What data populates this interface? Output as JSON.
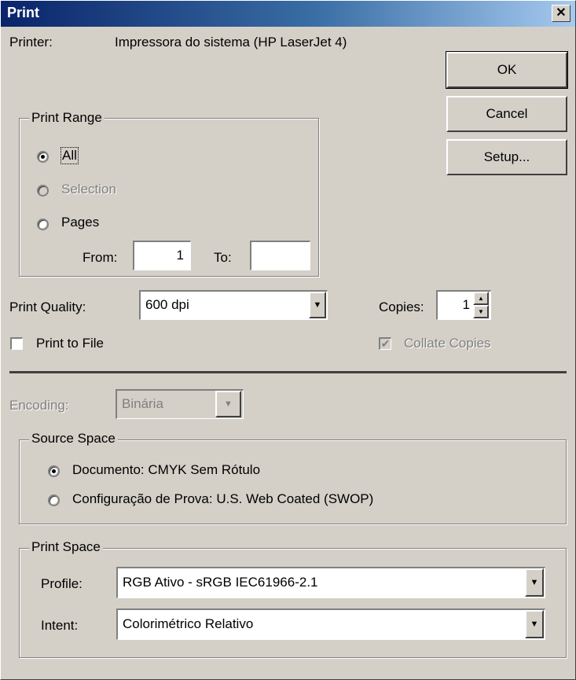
{
  "window": {
    "title": "Print",
    "close_glyph": "✕"
  },
  "printer": {
    "label": "Printer:",
    "value": "Impressora do sistema (HP LaserJet 4)"
  },
  "buttons": {
    "ok": "OK",
    "cancel": "Cancel",
    "setup": "Setup..."
  },
  "print_range": {
    "legend": "Print Range",
    "options": [
      {
        "label": "All",
        "checked": true,
        "enabled": true
      },
      {
        "label": "Selection",
        "checked": false,
        "enabled": false
      },
      {
        "label": "Pages",
        "checked": false,
        "enabled": true
      }
    ],
    "from_label": "From:",
    "from_value": "1",
    "to_label": "To:",
    "to_value": ""
  },
  "quality": {
    "label": "Print Quality:",
    "value": "600 dpi"
  },
  "copies": {
    "label": "Copies:",
    "value": "1"
  },
  "print_to_file": {
    "label": "Print to File",
    "checked": false
  },
  "collate": {
    "label": "Collate Copies",
    "checked": true,
    "enabled": false
  },
  "encoding": {
    "label": "Encoding:",
    "value": "Binária",
    "enabled": false
  },
  "source_space": {
    "legend": "Source Space",
    "options": [
      {
        "label": "Documento:  CMYK Sem Rótulo",
        "checked": true
      },
      {
        "label": "Configuração de Prova:  U.S. Web Coated (SWOP)",
        "checked": false
      }
    ]
  },
  "print_space": {
    "legend": "Print Space",
    "profile_label": "Profile:",
    "profile_value": "RGB Ativo - sRGB IEC61966-2.1",
    "intent_label": "Intent:",
    "intent_value": "Colorimétrico Relativo"
  },
  "icons": {
    "dropdown": "▼",
    "spin_up": "▲",
    "spin_down": "▼",
    "check": "✔"
  }
}
